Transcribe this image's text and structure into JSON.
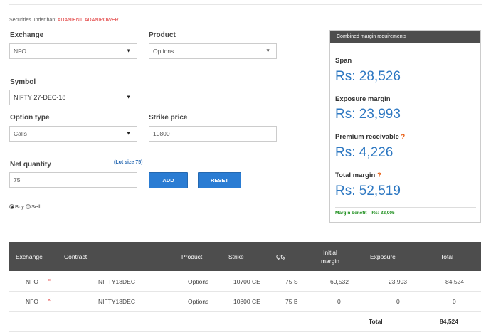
{
  "ban": {
    "label": "Securities under ban:",
    "list": "ADANIENT, ADANIPOWER"
  },
  "form": {
    "exchange_label": "Exchange",
    "exchange_value": "NFO",
    "product_label": "Product",
    "product_value": "Options",
    "symbol_label": "Symbol",
    "symbol_value": "NIFTY 27-DEC-18",
    "option_type_label": "Option type",
    "option_type_value": "Calls",
    "strike_label": "Strike price",
    "strike_value": "10800",
    "net_qty_label": "Net quantity",
    "lot_size": "(Lot size 75)",
    "net_qty_value": "75",
    "add_label": "ADD",
    "reset_label": "RESET",
    "buy_label": "Buy",
    "sell_label": "Sell",
    "buy_selected": true
  },
  "panel": {
    "title": "Combined margin requirements",
    "span_label": "Span",
    "span_value": "Rs: 28,526",
    "exposure_label": "Exposure margin",
    "exposure_value": "Rs: 23,993",
    "premium_label": "Premium receivable",
    "premium_value": "Rs: 4,226",
    "total_label": "Total margin",
    "total_value": "Rs: 52,519",
    "help_mark": "?",
    "benefit_label": "Margin benefit",
    "benefit_value": "Rs: 32,005"
  },
  "table": {
    "headers": {
      "exchange": "Exchange",
      "contract": "Contract",
      "product": "Product",
      "strike": "Strike",
      "qty": "Qty",
      "initial_1": "Initial",
      "initial_2": "margin",
      "exposure": "Exposure",
      "total": "Total"
    },
    "rows": [
      {
        "exchange": "NFO",
        "remove": "×",
        "contract": "NIFTY18DEC",
        "product": "Options",
        "strike": "10700 CE",
        "qty": "75 S",
        "initial": "60,532",
        "exposure": "23,993",
        "total": "84,524"
      },
      {
        "exchange": "NFO",
        "remove": "×",
        "contract": "NIFTY18DEC",
        "product": "Options",
        "strike": "10800 CE",
        "qty": "75 B",
        "initial": "0",
        "exposure": "0",
        "total": "0"
      }
    ],
    "footer_label": "Total",
    "footer_value": "84,524"
  },
  "colors": {
    "accent": "#2a7cd3",
    "value_blue": "#2e78c2",
    "danger": "#e03131",
    "success": "#1e8f1e",
    "header_bg": "#4d4d4d"
  },
  "icons": {
    "dropdown": "caret-down-icon",
    "remove": "close-icon",
    "help": "question-icon"
  }
}
